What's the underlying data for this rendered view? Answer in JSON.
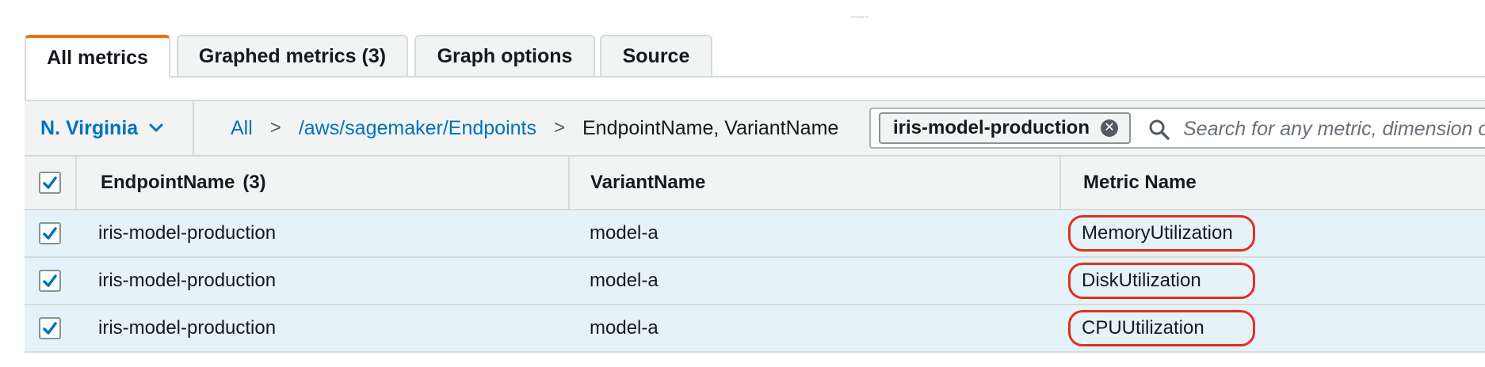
{
  "tabs": [
    {
      "label": "All metrics",
      "active": true
    },
    {
      "label": "Graphed metrics (3)",
      "active": false
    },
    {
      "label": "Graph options",
      "active": false
    },
    {
      "label": "Source",
      "active": false
    }
  ],
  "filter": {
    "region": "N. Virginia",
    "breadcrumb": [
      "All",
      "/aws/sagemaker/Endpoints",
      "EndpointName, VariantName"
    ],
    "token": "iris-model-production",
    "search_placeholder": "Search for any metric, dimension or resource id"
  },
  "table": {
    "columns": [
      "EndpointName",
      "(3)",
      "VariantName",
      "Metric Name"
    ],
    "rows": [
      {
        "endpoint": "iris-model-production",
        "variant": "model-a",
        "metric": "MemoryUtilization",
        "checked": true
      },
      {
        "endpoint": "iris-model-production",
        "variant": "model-a",
        "metric": "DiskUtilization",
        "checked": true
      },
      {
        "endpoint": "iris-model-production",
        "variant": "model-a",
        "metric": "CPUUtilization",
        "checked": true
      }
    ]
  },
  "colors": {
    "link": "#0073bb",
    "active_tab_accent": "#ec7211",
    "selected_row": "#e6f2fa",
    "highlight_outline": "#e0301e"
  },
  "icons": [
    "drag-handle-icon",
    "chevron-down-icon",
    "clear-token-icon",
    "search-icon",
    "checkmark-icon"
  ]
}
